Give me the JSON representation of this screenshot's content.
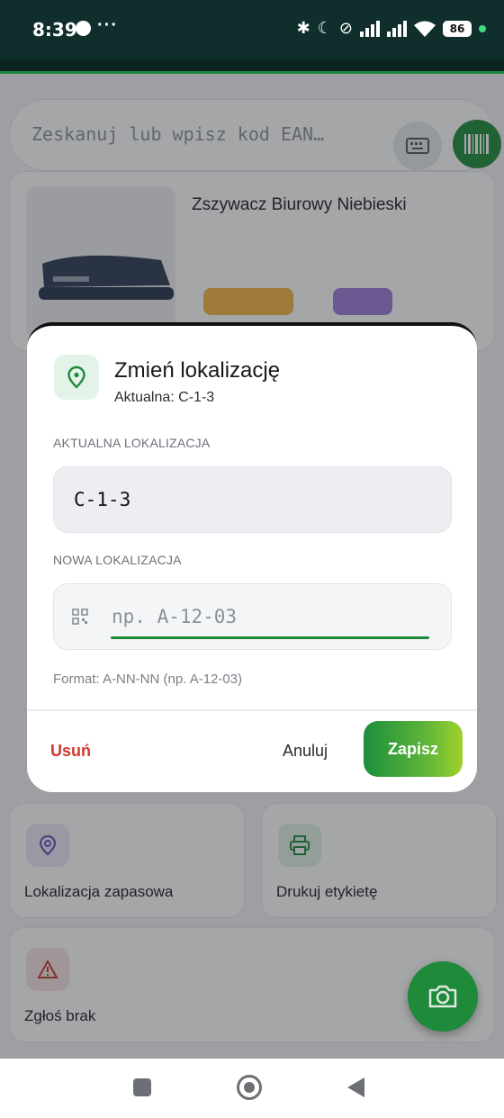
{
  "status_bar": {
    "time": "8:39",
    "more": "···",
    "battery": "86"
  },
  "search": {
    "placeholder": "Zeskanuj lub wpisz kod EAN…"
  },
  "product": {
    "title": "Zszywacz Biurowy Niebieski"
  },
  "actions": [
    {
      "label": "Lokalizacja zapasowa",
      "icon": "location-pin-icon"
    },
    {
      "label": "Drukuj etykietę",
      "icon": "printer-icon"
    },
    {
      "label": "Zgłoś brak",
      "icon": "warning-icon"
    }
  ],
  "dialog": {
    "title": "Zmień lokalizację",
    "subtitle": "Aktualna: C-1-3",
    "current_label": "AKTUALNA LOKALIZACJA",
    "current_value": "C-1-3",
    "new_label": "NOWA LOKALIZACJA",
    "new_placeholder": "np. A-12-03",
    "format_hint": "Format: A-NN-NN (np. A-12-03)",
    "buttons": {
      "delete": "Usuń",
      "cancel": "Anuluj",
      "save": "Zapisz"
    }
  },
  "colors": {
    "accent": "#1d8a3a",
    "danger": "#d03a30",
    "status_bar": "#0f2e2c"
  }
}
